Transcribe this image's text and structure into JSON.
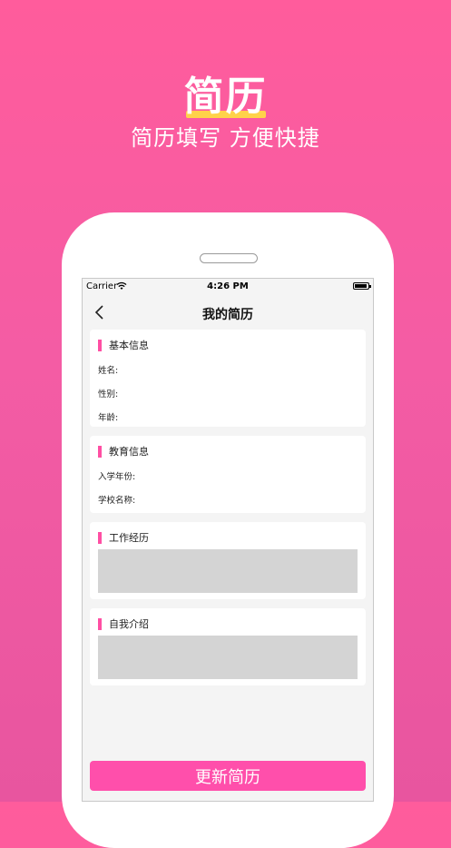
{
  "hero": {
    "title": "简历",
    "subtitle": "简历填写 方便快捷"
  },
  "status": {
    "carrier": "Carrier",
    "time": "4:26 PM"
  },
  "nav": {
    "title": "我的简历"
  },
  "sections": {
    "basic": {
      "title": "基本信息",
      "fields": [
        "姓名:",
        "性别:",
        "年龄:"
      ]
    },
    "education": {
      "title": "教育信息",
      "fields": [
        "入学年份:",
        "学校名称:"
      ]
    },
    "work": {
      "title": "工作经历"
    },
    "intro": {
      "title": "自我介绍"
    }
  },
  "update_button": "更新简历",
  "colors": {
    "accent": "#ff4fa3",
    "background": "#ff5c9c",
    "highlight": "#ffc83d"
  }
}
